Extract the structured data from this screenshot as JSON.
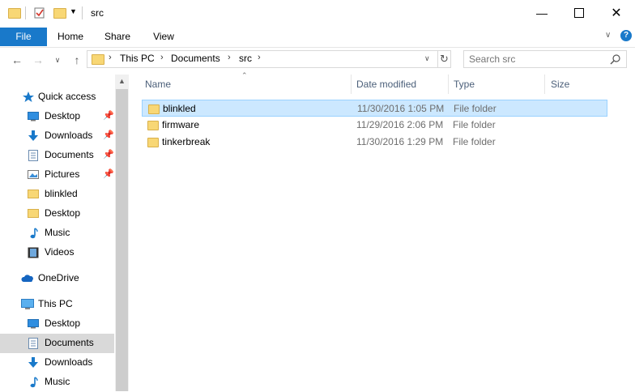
{
  "window": {
    "title": "src"
  },
  "ribbon": {
    "tabs": [
      "File",
      "Home",
      "Share",
      "View"
    ]
  },
  "address": {
    "crumbs": [
      "This PC",
      "Documents",
      "src"
    ]
  },
  "search": {
    "placeholder": "Search src"
  },
  "nav": {
    "quick_access": "Quick access",
    "quick_items": [
      {
        "label": "Desktop",
        "icon": "desktop-icon",
        "pinned": true
      },
      {
        "label": "Downloads",
        "icon": "downloads-icon",
        "pinned": true
      },
      {
        "label": "Documents",
        "icon": "documents-icon",
        "pinned": true
      },
      {
        "label": "Pictures",
        "icon": "pictures-icon",
        "pinned": true
      },
      {
        "label": "blinkled",
        "icon": "folder-icon",
        "pinned": false
      },
      {
        "label": "Desktop",
        "icon": "folder-icon",
        "pinned": false
      },
      {
        "label": "Music",
        "icon": "music-icon",
        "pinned": false
      },
      {
        "label": "Videos",
        "icon": "videos-icon",
        "pinned": false
      }
    ],
    "onedrive": "OneDrive",
    "this_pc": "This PC",
    "pc_items": [
      {
        "label": "Desktop",
        "icon": "desktop-icon"
      },
      {
        "label": "Documents",
        "icon": "documents-icon",
        "selected": true
      },
      {
        "label": "Downloads",
        "icon": "downloads-icon"
      },
      {
        "label": "Music",
        "icon": "music-icon"
      }
    ]
  },
  "columns": [
    "Name",
    "Date modified",
    "Type",
    "Size"
  ],
  "files": [
    {
      "name": "blinkled",
      "date": "11/30/2016 1:05 PM",
      "type": "File folder",
      "selected": true
    },
    {
      "name": "firmware",
      "date": "11/29/2016 2:06 PM",
      "type": "File folder",
      "selected": false
    },
    {
      "name": "tinkerbreak",
      "date": "11/30/2016 1:29 PM",
      "type": "File folder",
      "selected": false
    }
  ],
  "colors": {
    "accent": "#1979ca",
    "selection": "#cce8ff",
    "folder": "#f8d775"
  }
}
